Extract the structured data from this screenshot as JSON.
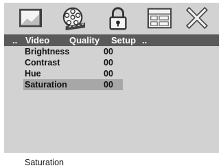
{
  "icon_bar": {
    "icons": [
      "picture-icon",
      "film-reel-icon",
      "padlock-icon",
      "screen-layout-icon",
      "close-x-icon"
    ]
  },
  "menu": {
    "prefix": "..",
    "items": [
      "Video",
      "Quality",
      "Setup"
    ],
    "suffix": ".."
  },
  "settings": [
    {
      "label": "Brightness",
      "value": "00"
    },
    {
      "label": "Contrast",
      "value": "00"
    },
    {
      "label": "Hue",
      "value": "00"
    },
    {
      "label": "Saturation",
      "value": "00"
    }
  ],
  "selected_index": 3,
  "status_text": "Saturation",
  "colors": {
    "panel": "#d2d2d2",
    "menu_bar": "#5a5a5a",
    "selection": "#a7a7a7"
  }
}
